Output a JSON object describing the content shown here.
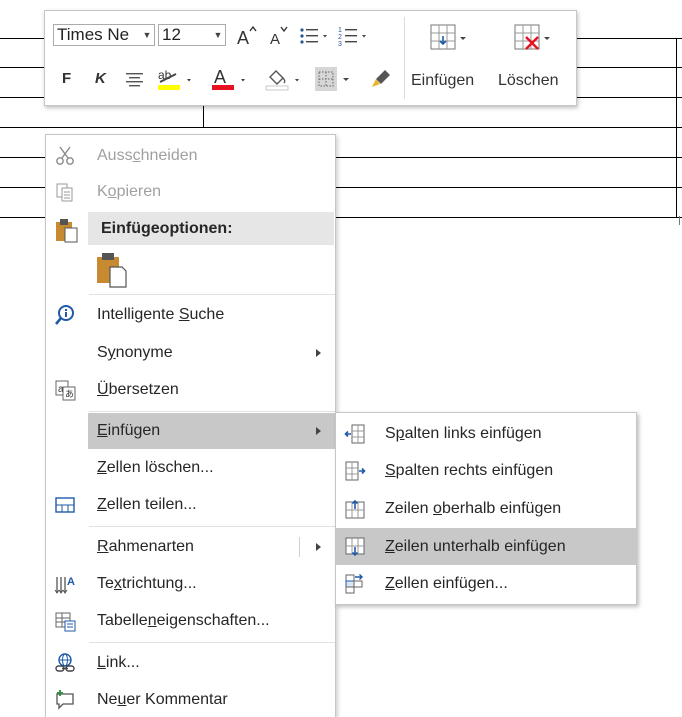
{
  "colors": {
    "menu_hover": "#c8c8c8",
    "paste_header_bg": "#e6e6e6",
    "highlight_yellow": "#ffff00",
    "font_color_red": "#e81123",
    "delete_red": "#e81123",
    "icon_blue": "#1e5aa8"
  },
  "toolbar": {
    "font_name": "Times Ne",
    "font_size": "12",
    "grow_font_icon": "A",
    "shrink_font_icon": "A",
    "bold_label": "F",
    "italic_label": "K",
    "highlight_label": "ab",
    "font_color_label": "A",
    "insert_label": "Einfügen",
    "delete_label": "Löschen"
  },
  "context_menu": {
    "items": [
      {
        "name": "cut",
        "pre": "Auss",
        "acc": "c",
        "post": "hneiden",
        "icon": "scissors-icon",
        "disabled": true
      },
      {
        "name": "copy",
        "pre": "K",
        "acc": "o",
        "post": "pieren",
        "icon": "copy-icon",
        "disabled": true
      },
      {
        "name": "paste-options",
        "label": "Einfügeoptionen:",
        "icon": "paste-icon"
      },
      {
        "name": "smart-lookup",
        "pre": "Intelligente ",
        "acc": "S",
        "post": "uche",
        "icon": "smart-lookup-icon"
      },
      {
        "name": "synonyms",
        "pre": "S",
        "acc": "y",
        "post": "nonyme",
        "icon": ""
      },
      {
        "name": "translate",
        "pre": "",
        "acc": "Ü",
        "post": "bersetzen",
        "icon": "translate-icon"
      },
      {
        "name": "insert",
        "pre": "",
        "acc": "E",
        "post": "infügen",
        "icon": ""
      },
      {
        "name": "delete-cells",
        "pre": "",
        "acc": "Z",
        "post": "ellen löschen...",
        "icon": ""
      },
      {
        "name": "split-cells",
        "pre": "",
        "acc": "Z",
        "post": "ellen teilen...",
        "icon": "split-cells-icon"
      },
      {
        "name": "border-styles",
        "pre": "",
        "acc": "R",
        "post": "ahmenarten",
        "icon": ""
      },
      {
        "name": "text-direction",
        "pre": "Te",
        "acc": "x",
        "post": "trichtung...",
        "icon": "text-direction-icon"
      },
      {
        "name": "table-properties",
        "pre": "Tabelle",
        "acc": "n",
        "post": "eigenschaften...",
        "icon": "table-properties-icon"
      },
      {
        "name": "link",
        "pre": "",
        "acc": "L",
        "post": "ink...",
        "icon": "link-icon"
      },
      {
        "name": "new-comment",
        "pre": "Ne",
        "acc": "u",
        "post": "er Kommentar",
        "icon": "new-comment-icon"
      }
    ]
  },
  "submenu": {
    "items": [
      {
        "name": "insert-columns-left",
        "pre": "S",
        "acc": "p",
        "post": "alten links einfügen",
        "icon": "insert-column-left-icon"
      },
      {
        "name": "insert-columns-right",
        "pre": "",
        "acc": "S",
        "post": "palten rechts einfügen",
        "icon": "insert-column-right-icon"
      },
      {
        "name": "insert-rows-above",
        "pre": "Zeilen ",
        "acc": "o",
        "post": "berhalb einfügen",
        "icon": "insert-row-above-icon"
      },
      {
        "name": "insert-rows-below",
        "pre": "",
        "acc": "Z",
        "post": "eilen unterhalb einfügen",
        "icon": "insert-row-below-icon"
      },
      {
        "name": "insert-cells",
        "pre": "",
        "acc": "Z",
        "post": "ellen einfügen...",
        "icon": "insert-cells-icon"
      }
    ]
  }
}
